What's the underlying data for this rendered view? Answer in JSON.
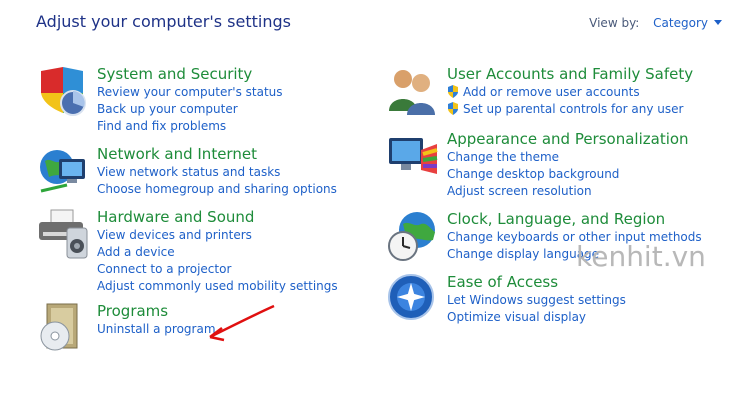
{
  "header": {
    "title": "Adjust your computer's settings",
    "view_by_label": "View by:",
    "view_by_value": "Category"
  },
  "categories": [
    {
      "title": "System and Security",
      "icon": "shield-pie-icon",
      "links": [
        "Review your computer's status",
        "Back up your computer",
        "Find and fix problems"
      ]
    },
    {
      "title": "Network and Internet",
      "icon": "globe-network-icon",
      "links": [
        "View network status and tasks",
        "Choose homegroup and sharing options"
      ]
    },
    {
      "title": "Hardware and Sound",
      "icon": "printer-speaker-icon",
      "links": [
        "View devices and printers",
        "Add a device",
        "Connect to a projector",
        "Adjust commonly used mobility settings"
      ]
    },
    {
      "title": "Programs",
      "icon": "programs-disc-icon",
      "links": [
        "Uninstall a program"
      ]
    },
    {
      "title": "User Accounts and Family Safety",
      "icon": "users-icon",
      "links": [
        "Add or remove user accounts",
        "Set up parental controls for any user"
      ]
    },
    {
      "title": "Appearance and Personalization",
      "icon": "monitor-palette-icon",
      "links": [
        "Change the theme",
        "Change desktop background",
        "Adjust screen resolution"
      ]
    },
    {
      "title": "Clock, Language, and Region",
      "icon": "globe-clock-icon",
      "links": [
        "Change keyboards or other input methods",
        "Change display language"
      ]
    },
    {
      "title": "Ease of Access",
      "icon": "ease-of-access-icon",
      "links": [
        "Let Windows suggest settings",
        "Optimize visual display"
      ]
    }
  ],
  "watermark": "kenhit.vn",
  "colors": {
    "title": "#1e3287",
    "category": "#1e8c3a",
    "link": "#1e60c8",
    "annotation_arrow": "#e01010"
  }
}
